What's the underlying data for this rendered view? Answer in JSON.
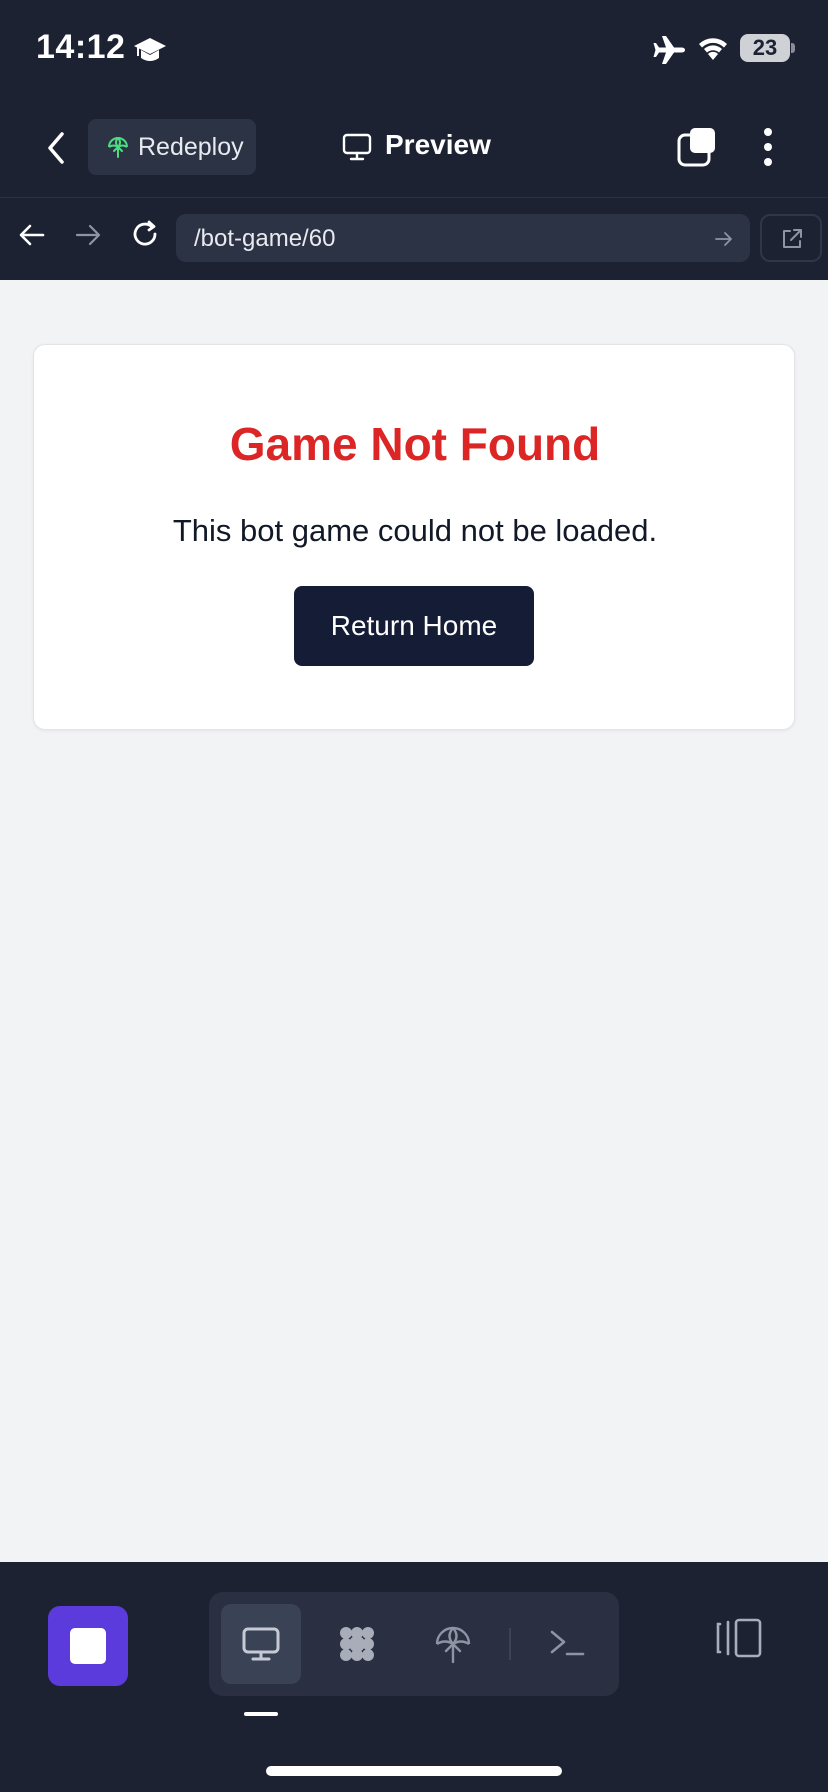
{
  "status": {
    "time": "14:12",
    "battery": "23"
  },
  "header": {
    "redeploy_label": "Redeploy",
    "title": "Preview"
  },
  "urlbar": {
    "path": "/bot-game/60"
  },
  "page": {
    "title": "Game Not Found",
    "message": "This bot game could not be loaded.",
    "button_label": "Return Home"
  },
  "toolbar": {
    "tabs": [
      {
        "icon": "monitor-icon",
        "active": true
      },
      {
        "icon": "grid-dots-icon",
        "active": false
      },
      {
        "icon": "deploy-icon",
        "active": false
      },
      {
        "icon": "terminal-icon",
        "active": false
      }
    ]
  },
  "colors": {
    "error_title": "#dc2626",
    "primary_button": "#151c35",
    "stop_button": "#5b3bdc",
    "chrome_bg": "#1d2233",
    "redeploy_icon": "#4ade80"
  }
}
